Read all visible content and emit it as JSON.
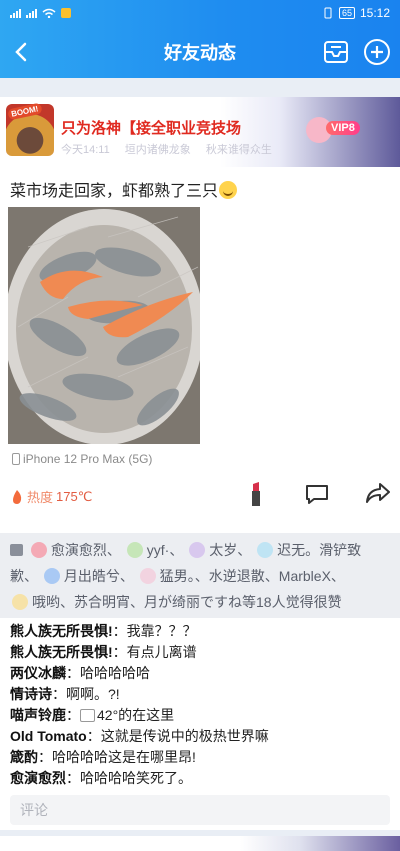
{
  "status_bar": {
    "time": "15:12",
    "battery": "65",
    "carrier_icons": [
      "signal-4g-icon",
      "signal-4g-icon",
      "wifi-icon"
    ]
  },
  "nav": {
    "title": "好友动态",
    "back_icon": "chevron-left-icon",
    "message_icon": "message-box-icon",
    "add_icon": "plus-circle-icon"
  },
  "post": {
    "author": "只为洛神【接全职业竞技场",
    "time": "今天14:11",
    "meta_extra": [
      "垣内诸佛龙象",
      "秋来谁得众生"
    ],
    "vip_label": "VIP8",
    "avatar_tag": "BOOM!",
    "text": "菜市场走回家，虾都熟了三只",
    "device": "iPhone 12 Pro Max (5G)",
    "heat_label": "热度",
    "heat_value": "175℃"
  },
  "likes": {
    "line1": [
      "愈演愈烈、",
      "yyf·、",
      "太岁、",
      "迟无。滑铲致"
    ],
    "line2": [
      "歉、",
      "月出皓兮、",
      "猛男。、水逆退散、MarbleX、"
    ],
    "line3": [
      "哦哟、苏合明宵、月が绮丽ですね等18人觉得很赞"
    ]
  },
  "comments": [
    {
      "user": "熊人族无所畏惧!",
      "text": "：我靠？？？"
    },
    {
      "user": "熊人族无所畏惧!",
      "text": "：有点儿离谱"
    },
    {
      "user": "两仪冰麟",
      "text": "：哈哈哈哈哈"
    },
    {
      "user": "情诗诗",
      "text": "：啊啊。?!"
    },
    {
      "user": "喵声铃鹿",
      "text": "42°的在这里",
      "has_image": true
    },
    {
      "user": "Old Tomato",
      "text": "：这就是传说中的极热世界嘛"
    },
    {
      "user": "箴酌",
      "text": "：哈哈哈哈这是在哪里昂!"
    },
    {
      "user": "愈演愈烈",
      "text": "：哈哈哈哈笑死了。"
    }
  ],
  "comment_input": {
    "placeholder": "评论"
  },
  "colors": {
    "accent": "#1f8df0",
    "author": "#e02a20",
    "heat": "#e25c42"
  }
}
